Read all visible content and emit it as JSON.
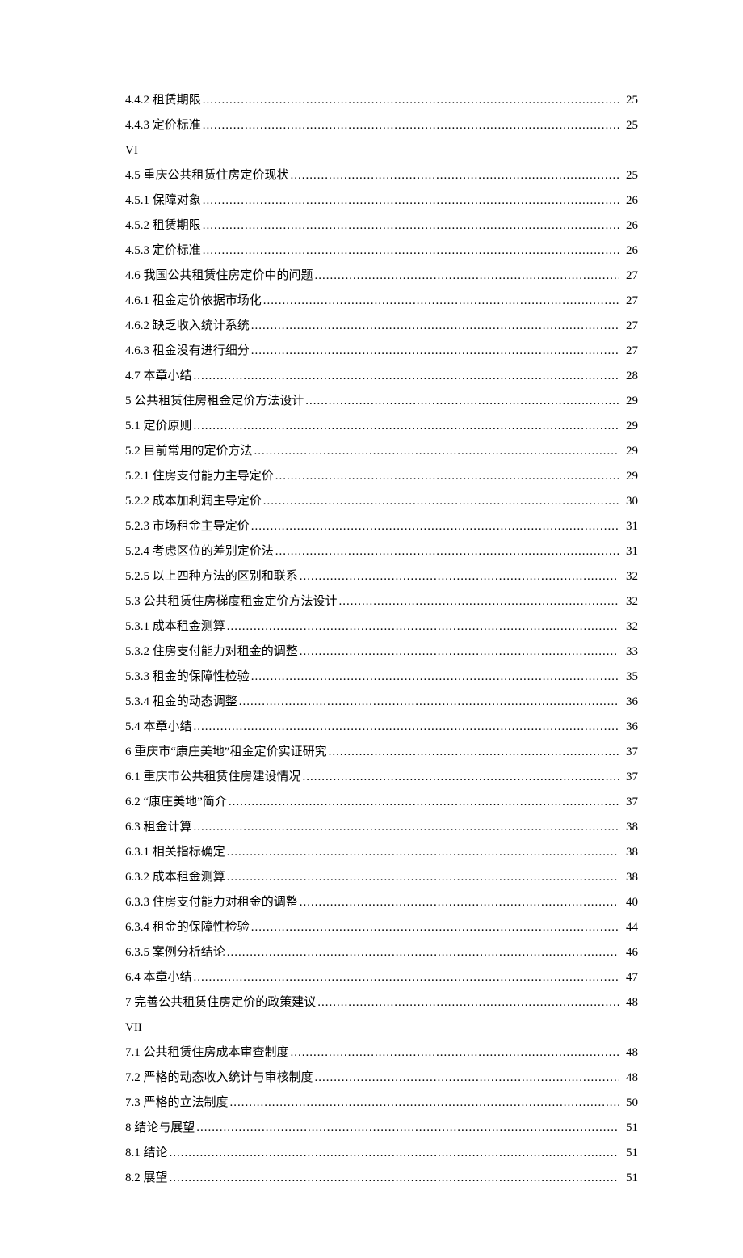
{
  "toc": [
    {
      "type": "entry",
      "label": "4.4.2  租赁期限 ",
      "page": " 25"
    },
    {
      "type": "entry",
      "label": "4.4.3  定价标准 ",
      "page": " 25"
    },
    {
      "type": "roman",
      "label": "VI"
    },
    {
      "type": "entry",
      "label": "4.5  重庆公共租赁住房定价现状",
      "page": " 25"
    },
    {
      "type": "entry",
      "label": "4.5.1  保障对象 ",
      "page": " 26"
    },
    {
      "type": "entry",
      "label": "4.5.2  租赁期限 ",
      "page": " 26"
    },
    {
      "type": "entry",
      "label": "4.5.3  定价标准 ",
      "page": " 26"
    },
    {
      "type": "entry",
      "label": "4.6  我国公共租赁住房定价中的问题",
      "page": " 27"
    },
    {
      "type": "entry",
      "label": "4.6.1  租金定价依据市场化 ",
      "page": " 27"
    },
    {
      "type": "entry",
      "label": "4.6.2  缺乏收入统计系统 ",
      "page": " 27"
    },
    {
      "type": "entry",
      "label": "4.6.3  租金没有进行细分 ",
      "page": " 27"
    },
    {
      "type": "entry",
      "label": "4.7  本章小结",
      "page": " 28"
    },
    {
      "type": "entry",
      "label": "5  公共租赁住房租金定价方法设计 ",
      "page": "29"
    },
    {
      "type": "entry",
      "label": "5.1  定价原则",
      "page": " 29"
    },
    {
      "type": "entry",
      "label": "5.2  目前常用的定价方法",
      "page": " 29"
    },
    {
      "type": "entry",
      "label": "5.2.1  住房支付能力主导定价 ",
      "page": " 29"
    },
    {
      "type": "entry",
      "label": "5.2.2  成本加利润主导定价 ",
      "page": " 30"
    },
    {
      "type": "entry",
      "label": "5.2.3  市场租金主导定价 ",
      "page": " 31"
    },
    {
      "type": "entry",
      "label": "5.2.4  考虑区位的差别定价法 ",
      "page": " 31"
    },
    {
      "type": "entry",
      "label": "5.2.5  以上四种方法的区别和联系 ",
      "page": " 32"
    },
    {
      "type": "entry",
      "label": "5.3  公共租赁住房梯度租金定价方法设计",
      "page": " 32"
    },
    {
      "type": "entry",
      "label": "5.3.1  成本租金测算 ",
      "page": " 32"
    },
    {
      "type": "entry",
      "label": "5.3.2  住房支付能力对租金的调整 ",
      "page": " 33"
    },
    {
      "type": "entry",
      "label": "5.3.3  租金的保障性检验 ",
      "page": " 35"
    },
    {
      "type": "entry",
      "label": "5.3.4  租金的动态调整 ",
      "page": " 36"
    },
    {
      "type": "entry",
      "label": "5.4  本章小结",
      "page": " 36"
    },
    {
      "type": "entry",
      "label": "6  重庆市“康庄美地”租金定价实证研究 ",
      "page": "37"
    },
    {
      "type": "entry",
      "label": "6.1  重庆市公共租赁住房建设情况",
      "page": " 37"
    },
    {
      "type": "entry",
      "label": "6.2  “康庄美地”简介",
      "page": " 37"
    },
    {
      "type": "entry",
      "label": "6.3  租金计算",
      "page": " 38"
    },
    {
      "type": "entry",
      "label": "6.3.1  相关指标确定 ",
      "page": " 38"
    },
    {
      "type": "entry",
      "label": "6.3.2  成本租金测算 ",
      "page": " 38"
    },
    {
      "type": "entry",
      "label": "6.3.3  住房支付能力对租金的调整 ",
      "page": " 40"
    },
    {
      "type": "entry",
      "label": "6.3.4  租金的保障性检验 ",
      "page": " 44"
    },
    {
      "type": "entry",
      "label": "6.3.5  案例分析结论 ",
      "page": " 46"
    },
    {
      "type": "entry",
      "label": "6.4  本章小结",
      "page": " 47"
    },
    {
      "type": "entry",
      "label": "7  完善公共租赁住房定价的政策建议 ",
      "page": "48"
    },
    {
      "type": "roman",
      "label": "VII"
    },
    {
      "type": "entry",
      "label": "7.1  公共租赁住房成本审查制度",
      "page": " 48"
    },
    {
      "type": "entry",
      "label": "7.2  严格的动态收入统计与审核制度",
      "page": " 48"
    },
    {
      "type": "entry",
      "label": "7.3  严格的立法制度",
      "page": " 50"
    },
    {
      "type": "entry",
      "label": "8  结论与展望 ",
      "page": "51"
    },
    {
      "type": "entry",
      "label": "8.1  结论",
      "page": " 51"
    },
    {
      "type": "entry",
      "label": "8.2  展望",
      "page": " 51"
    }
  ]
}
